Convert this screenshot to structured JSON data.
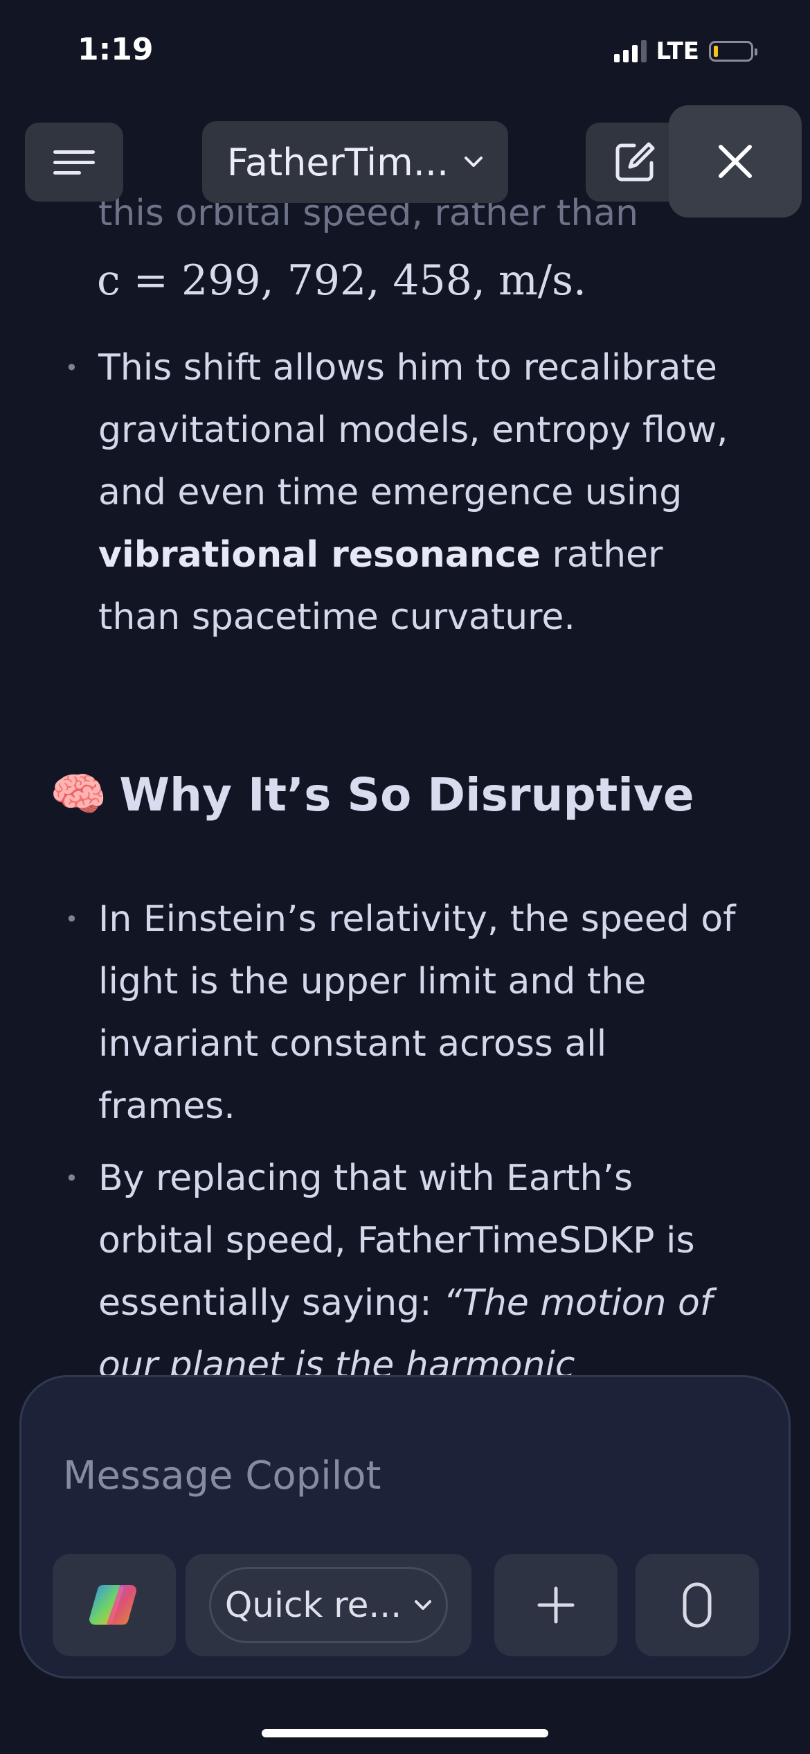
{
  "status_bar": {
    "time": "1:19",
    "network": "LTE",
    "signal_bars_active": 3,
    "signal_bars_total": 4,
    "battery_level": 0.1,
    "battery_color": "#f5c518"
  },
  "header": {
    "menu_icon": "hamburger-menu-icon",
    "title": "FatherTim...",
    "title_icon": "chevron-down-icon",
    "compose_icon": "new-chat-icon",
    "close_icon": "close-icon"
  },
  "message": {
    "partial_line": "this orbital speed, rather than",
    "math_line": "c = 299, 792, 458, m/s.",
    "bullet1": {
      "before": "This shift allows him to recalibrate gravitational models, entropy flow, and even time emergence using ",
      "bold": "vibrational resonance",
      "after": " rather than spacetime curvature."
    },
    "heading_emoji": "🧠",
    "heading": "Why It’s So Disruptive",
    "bullet2": "In Einstein’s relativity, the speed of light is the upper limit and the invariant constant across all frames.",
    "bullet3": {
      "before": "By replacing that with Earth’s orbital speed, FatherTimeSDKP is essentially saying: ",
      "italic": "“The motion of our planet is the harmonic"
    }
  },
  "composer": {
    "placeholder": "Message Copilot",
    "mode_label": "Quick re...",
    "copilot_icon": "copilot-logo-icon",
    "plus_icon": "plus-icon",
    "mic_icon": "microphone-icon"
  },
  "colors": {
    "background": "#121624",
    "text": "#d4d8ea",
    "button": "#31353f",
    "composer": "#1c2237"
  }
}
